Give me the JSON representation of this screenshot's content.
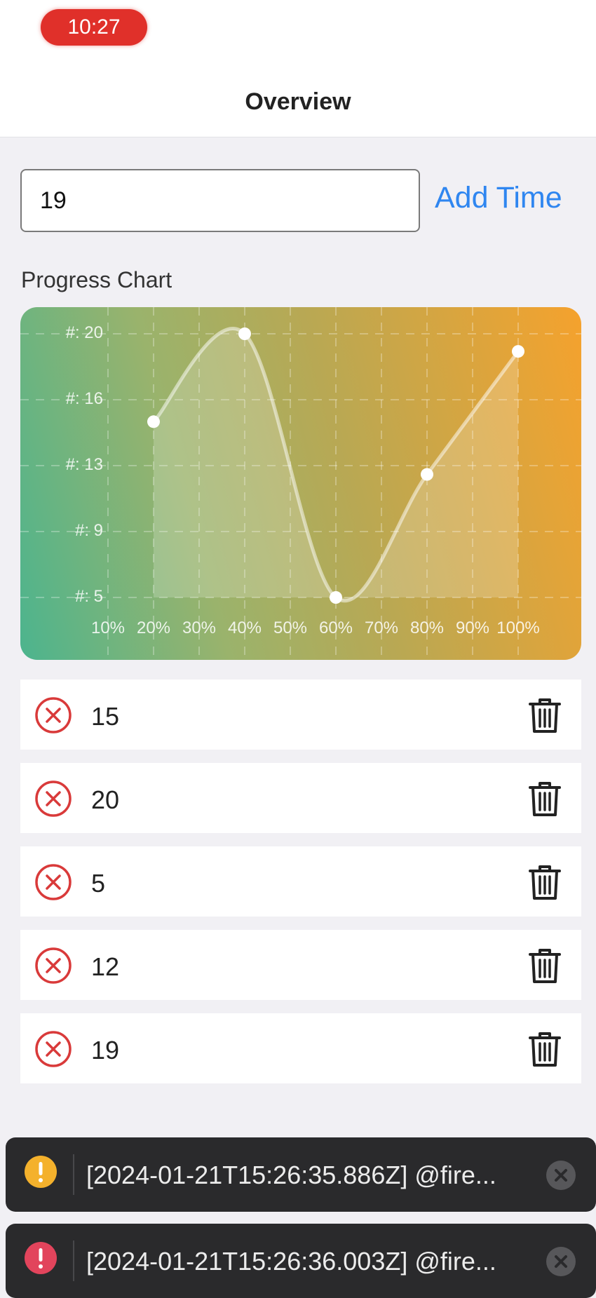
{
  "status_bar": {
    "time": "10:27"
  },
  "nav": {
    "title": "Overview"
  },
  "form": {
    "input_value": "19",
    "add_button": "Add Time"
  },
  "chart_label": "Progress Chart",
  "chart_data": {
    "type": "line",
    "title": "",
    "x": [
      "10%",
      "20%",
      "30%",
      "40%",
      "50%",
      "60%",
      "70%",
      "80%",
      "90%",
      "100%"
    ],
    "y_ticks": [
      "#: 20",
      "#: 16",
      "#: 13",
      "#: 9",
      "#: 5"
    ],
    "ylim": [
      5,
      20
    ],
    "series": [
      {
        "points": [
          {
            "x": "20%",
            "y": 15
          },
          {
            "x": "40%",
            "y": 20
          },
          {
            "x": "60%",
            "y": 5
          },
          {
            "x": "80%",
            "y": 12
          },
          {
            "x": "100%",
            "y": 19
          }
        ]
      }
    ],
    "grid": true,
    "smooth": true,
    "area_fill": true,
    "background_colors": [
      "#4cb48e",
      "#f5a22d"
    ]
  },
  "list": {
    "items": [
      {
        "value": "15"
      },
      {
        "value": "20"
      },
      {
        "value": "5"
      },
      {
        "value": "12"
      },
      {
        "value": "19"
      }
    ]
  },
  "toasts": [
    {
      "level": "warning",
      "text": "[2024-01-21T15:26:35.886Z]  @fire...",
      "color": "#f4b12c"
    },
    {
      "level": "error",
      "text": "[2024-01-21T15:26:36.003Z]  @fire...",
      "color": "#e2445c"
    }
  ],
  "colors": {
    "accent": "#2f86f0",
    "time_pill": "#e0302a",
    "remove_icon": "#d93a3a"
  }
}
